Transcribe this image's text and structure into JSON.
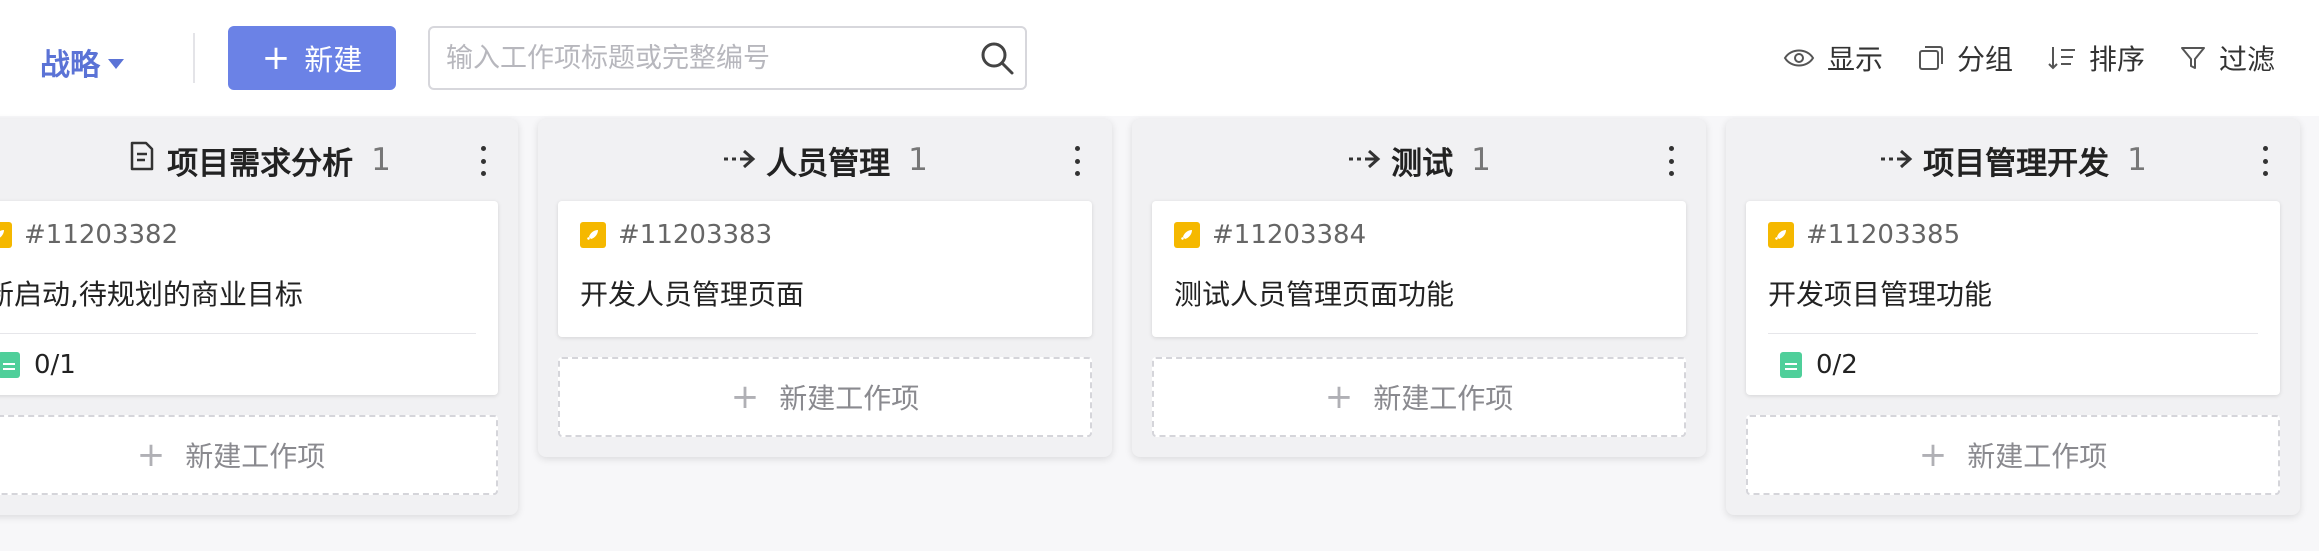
{
  "toolbar": {
    "view": "战略",
    "new_label": "新建",
    "search_placeholder": "输入工作项标题或完整编号",
    "tools": [
      {
        "label": "显示",
        "icon": "eye-icon"
      },
      {
        "label": "分组",
        "icon": "group-icon"
      },
      {
        "label": "排序",
        "icon": "sort-icon"
      },
      {
        "label": "过滤",
        "icon": "filter-icon"
      }
    ]
  },
  "colors": {
    "accent": "#6b82e6",
    "view_text": "#5b73d6",
    "badge": "#f5b800",
    "doc": "#4fcf9a"
  },
  "columns": [
    {
      "title": "项目需求分析",
      "icon": "document-icon",
      "count": "1",
      "card": {
        "id": "#11203382",
        "title": "新启动,待规划的商业目标",
        "subtasks": "0/1"
      },
      "add_label": "新建工作项"
    },
    {
      "title": "人员管理",
      "icon": "flow-arrow-icon",
      "count": "1",
      "card": {
        "id": "#11203383",
        "title": "开发人员管理页面",
        "subtasks": null
      },
      "add_label": "新建工作项"
    },
    {
      "title": "测试",
      "icon": "flow-arrow-icon",
      "count": "1",
      "card": {
        "id": "#11203384",
        "title": "测试人员管理页面功能",
        "subtasks": null
      },
      "add_label": "新建工作项"
    },
    {
      "title": "项目管理开发",
      "icon": "flow-arrow-icon",
      "count": "1",
      "card": {
        "id": "#11203385",
        "title": "开发项目管理功能",
        "subtasks": "0/2"
      },
      "add_label": "新建工作项"
    }
  ]
}
